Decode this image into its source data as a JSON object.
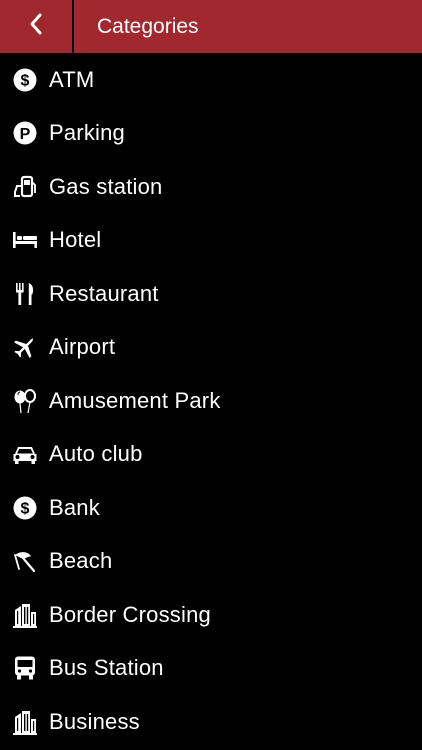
{
  "header": {
    "title": "Categories",
    "back_icon": "chevron-left-icon",
    "background_color": "#a0282e"
  },
  "categories": [
    {
      "label": "ATM",
      "icon": "dollar-circle-icon"
    },
    {
      "label": "Parking",
      "icon": "parking-icon"
    },
    {
      "label": "Gas station",
      "icon": "gas-pump-icon"
    },
    {
      "label": "Hotel",
      "icon": "bed-icon"
    },
    {
      "label": "Restaurant",
      "icon": "fork-knife-icon"
    },
    {
      "label": "Airport",
      "icon": "airplane-icon"
    },
    {
      "label": "Amusement Park",
      "icon": "balloons-icon"
    },
    {
      "label": "Auto club",
      "icon": "car-icon"
    },
    {
      "label": "Bank",
      "icon": "dollar-circle-icon"
    },
    {
      "label": "Beach",
      "icon": "beach-umbrella-icon"
    },
    {
      "label": "Border Crossing",
      "icon": "building-icon"
    },
    {
      "label": "Bus Station",
      "icon": "bus-icon"
    },
    {
      "label": "Business",
      "icon": "building-icon"
    }
  ]
}
